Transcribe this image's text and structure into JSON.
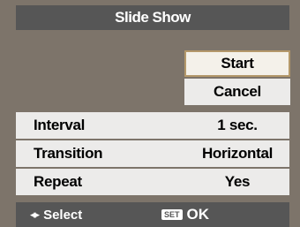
{
  "title": "Slide Show",
  "buttons": {
    "start": "Start",
    "cancel": "Cancel"
  },
  "settings": [
    {
      "label": "Interval",
      "value": "1 sec."
    },
    {
      "label": "Transition",
      "value": "Horizontal"
    },
    {
      "label": "Repeat",
      "value": "Yes"
    }
  ],
  "footer": {
    "select_icon": "left-right-arrows-icon",
    "select_label": "Select",
    "set_icon_text": "SET",
    "ok_label": "OK"
  },
  "colors": {
    "background": "#7d746a",
    "title_bar": "#565656",
    "row": "#ecebea",
    "selected_border": "#b4986a"
  }
}
